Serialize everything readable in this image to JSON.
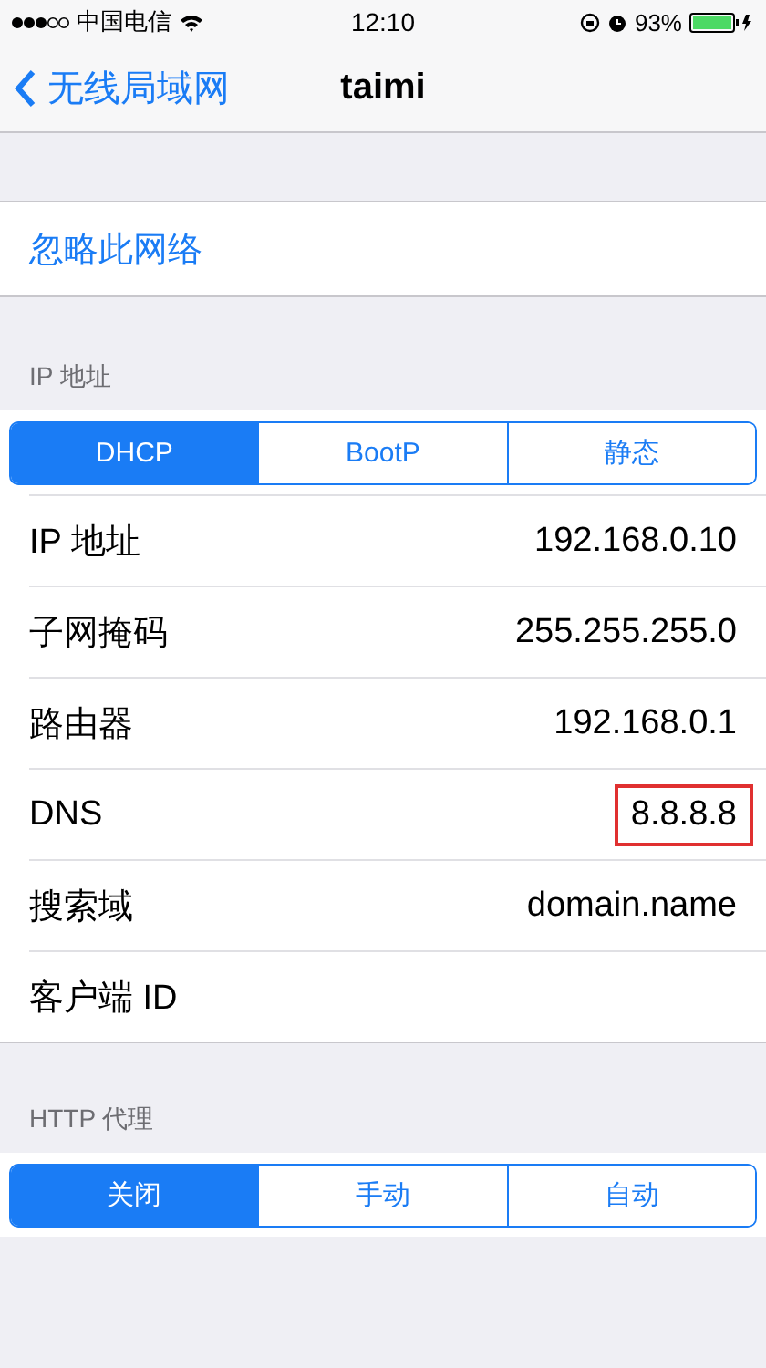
{
  "status_bar": {
    "carrier": "中国电信",
    "time": "12:10",
    "battery": "93%"
  },
  "nav": {
    "back": "无线局域网",
    "title": "taimi"
  },
  "forget": "忽略此网络",
  "ip_section": {
    "header": "IP 地址",
    "segments": [
      {
        "label": "DHCP",
        "selected": true
      },
      {
        "label": "BootP",
        "selected": false
      },
      {
        "label": "静态",
        "selected": false
      }
    ],
    "rows": [
      {
        "label": "IP 地址",
        "value": "192.168.0.10"
      },
      {
        "label": "子网掩码",
        "value": "255.255.255.0"
      },
      {
        "label": "路由器",
        "value": "192.168.0.1"
      },
      {
        "label": "DNS",
        "value": "8.8.8.8",
        "highlighted": true
      },
      {
        "label": "搜索域",
        "value": "domain.name"
      },
      {
        "label": "客户端 ID"
      }
    ]
  },
  "proxy_section": {
    "header": "HTTP 代理",
    "segments": [
      {
        "label": "关闭",
        "selected": true
      },
      {
        "label": "手动",
        "selected": false
      },
      {
        "label": "自动",
        "selected": false
      }
    ]
  }
}
